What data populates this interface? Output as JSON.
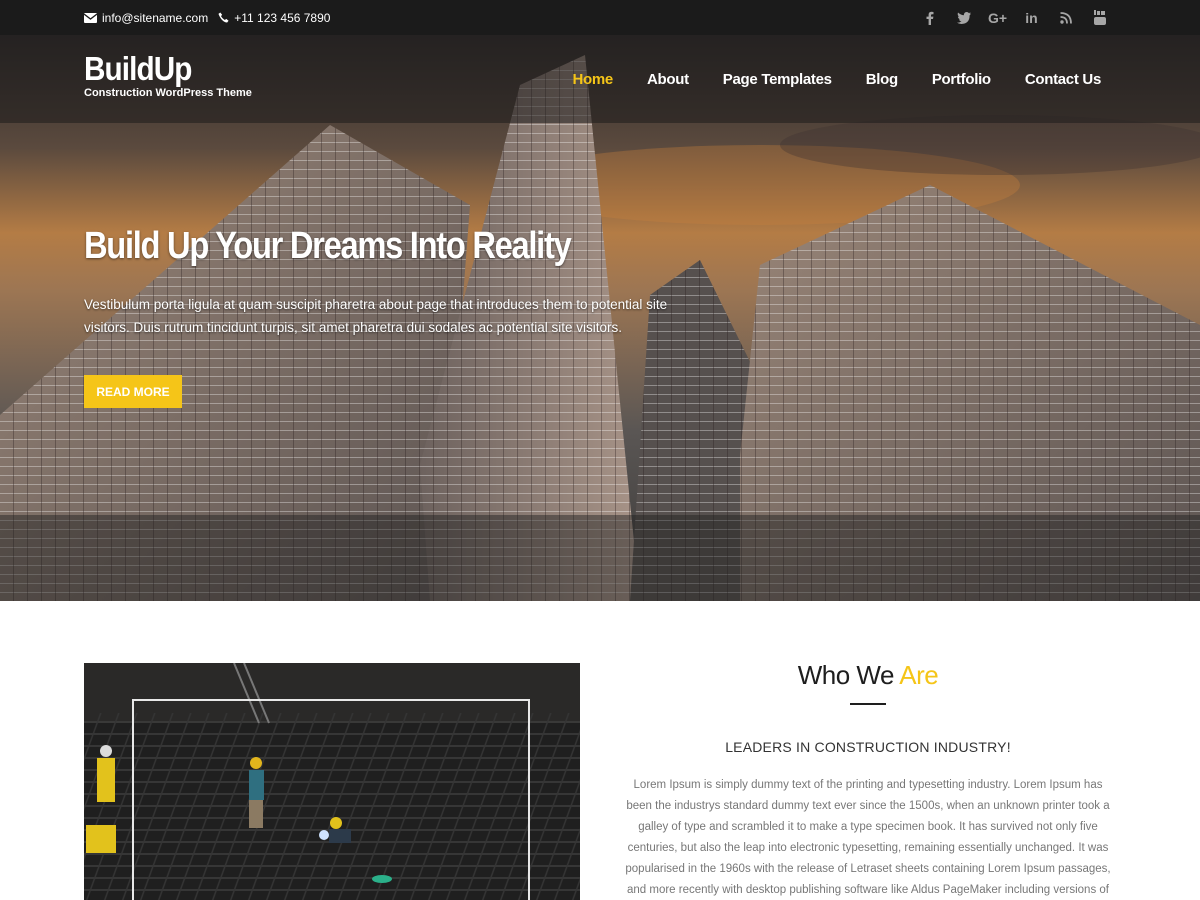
{
  "topbar": {
    "email": "info@sitename.com",
    "phone": "+11 123 456 7890",
    "social": [
      {
        "icon": "facebook-icon",
        "glyph": "f"
      },
      {
        "icon": "twitter-icon",
        "glyph": "t"
      },
      {
        "icon": "google-plus-icon",
        "glyph": "G+"
      },
      {
        "icon": "linkedin-icon",
        "glyph": "in"
      },
      {
        "icon": "rss-icon",
        "glyph": "rss"
      },
      {
        "icon": "youtube-icon",
        "glyph": "yt"
      }
    ]
  },
  "header": {
    "site_title": "BuildUp",
    "tagline": "Construction WordPress Theme",
    "menu": [
      {
        "label": "Home",
        "active": true
      },
      {
        "label": "About",
        "active": false
      },
      {
        "label": "Page Templates",
        "active": false
      },
      {
        "label": "Blog",
        "active": false
      },
      {
        "label": "Portfolio",
        "active": false
      },
      {
        "label": "Contact Us",
        "active": false
      }
    ]
  },
  "hero": {
    "title": "Build Up Your Dreams Into Reality",
    "text": "Vestibulum porta ligula at quam suscipit pharetra about page that introduces them to potential site visitors. Duis rutrum tincidunt turpis, sit amet pharetra dui sodales ac potential site visitors.",
    "button_label": "READ MORE"
  },
  "about": {
    "title_main": "Who We ",
    "title_accent": "Are",
    "subtitle": "LEADERS IN CONSTRUCTION INDUSTRY!",
    "body": "Lorem Ipsum is simply dummy text of the printing and typesetting industry. Lorem Ipsum has been the industrys standard dummy text ever since the 1500s, when an unknown printer took a galley of type and scrambled it to make a type specimen book. It has survived not only five centuries, but also the leap into electronic typesetting, remaining essentially unchanged. It was popularised in the 1960s with the release of Letraset sheets containing Lorem Ipsum passages, and more recently with desktop publishing software like Aldus PageMaker including versions of Lorem Ipsum. Why do we use it?"
  },
  "colors": {
    "accent": "#f5c518",
    "topbar_bg": "#1b1b1b"
  }
}
